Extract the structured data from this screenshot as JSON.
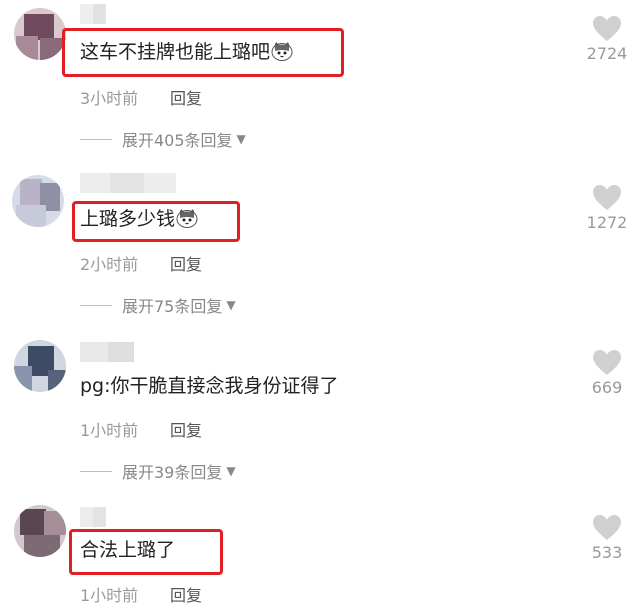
{
  "comments": [
    {
      "text": "这车不挂牌也能上璐吧",
      "time": "3小时前",
      "reply_label": "回复",
      "expand_label": "展开405条回复",
      "likes": "2724",
      "has_emoji": true,
      "highlighted": true
    },
    {
      "text": "上璐多少钱",
      "time": "2小时前",
      "reply_label": "回复",
      "expand_label": "展开75条回复",
      "likes": "1272",
      "has_emoji": true,
      "highlighted": true
    },
    {
      "text": "pg:你干脆直接念我身份证得了",
      "time": "1小时前",
      "reply_label": "回复",
      "expand_label": "展开39条回复",
      "likes": "669",
      "has_emoji": false,
      "highlighted": false
    },
    {
      "text": "合法上璐了",
      "time": "1小时前",
      "reply_label": "回复",
      "likes": "533",
      "has_emoji": false,
      "highlighted": true
    }
  ],
  "icons": {
    "like": "heart-icon",
    "emoji": "cat-face-emoji-icon",
    "expand_caret": "caret-down-icon"
  },
  "colors": {
    "highlight_border": "#e21f25",
    "heart": "#d0d0d0",
    "muted_text": "#9a9a9a"
  }
}
